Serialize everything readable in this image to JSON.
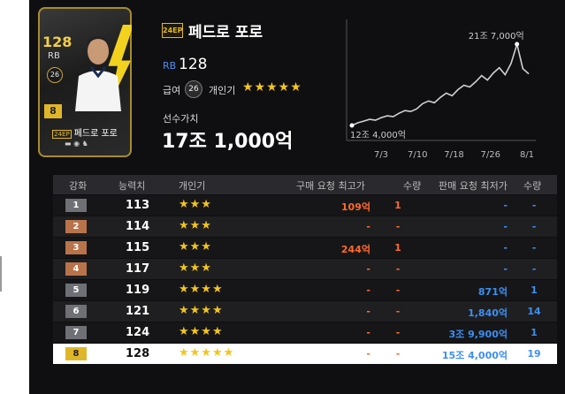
{
  "player": {
    "season_badge": "24EP",
    "name": "페드로 포로",
    "position": "RB",
    "ovr": "128",
    "wage_label": "급여",
    "wage_value": "26",
    "skill_label": "개인기",
    "skill_stars": "★★★★★",
    "value_label": "선수가치",
    "value": "17조 1,000억"
  },
  "card": {
    "ovr": "128",
    "position": "RB",
    "badge": "26",
    "level": "8",
    "name": "페드로 포로",
    "season_badge": "24EP"
  },
  "chart_data": {
    "type": "line",
    "x_ticks": [
      "7/3",
      "7/10",
      "7/18",
      "7/26",
      "8/1"
    ],
    "annotations": [
      {
        "text": "21조 7,000억",
        "role": "max"
      },
      {
        "text": "12조 4,000억",
        "role": "min"
      }
    ],
    "series": [
      {
        "values": [
          12.4,
          12.7,
          12.9,
          13.1,
          13.0,
          13.3,
          13.5,
          13.4,
          13.8,
          14.1,
          14.0,
          14.3,
          14.9,
          15.2,
          15.0,
          15.6,
          16.1,
          15.8,
          16.5,
          17.0,
          16.8,
          17.4,
          18.1,
          17.6,
          18.4,
          19.0,
          18.2,
          19.5,
          21.7,
          18.9,
          18.3
        ]
      }
    ]
  },
  "table": {
    "headers": {
      "level": "강화",
      "ovr": "능력치",
      "skill": "개인기",
      "buy_max": "구매 요청 최고가",
      "buy_qty": "수량",
      "sell_min": "판매 요청 최저가",
      "sell_qty": "수량"
    },
    "rows": [
      {
        "level": "1",
        "ovr": "113",
        "stars": "★★★",
        "buy": "109억",
        "buy_qty": "1",
        "sell": "-",
        "sell_qty": "-"
      },
      {
        "level": "2",
        "ovr": "114",
        "stars": "★★★",
        "buy": "-",
        "buy_qty": "-",
        "sell": "-",
        "sell_qty": "-"
      },
      {
        "level": "3",
        "ovr": "115",
        "stars": "★★★",
        "buy": "244억",
        "buy_qty": "1",
        "sell": "-",
        "sell_qty": "-"
      },
      {
        "level": "4",
        "ovr": "117",
        "stars": "★★★",
        "buy": "-",
        "buy_qty": "-",
        "sell": "-",
        "sell_qty": "-"
      },
      {
        "level": "5",
        "ovr": "119",
        "stars": "★★★★",
        "buy": "-",
        "buy_qty": "-",
        "sell": "871억",
        "sell_qty": "1"
      },
      {
        "level": "6",
        "ovr": "121",
        "stars": "★★★★",
        "buy": "-",
        "buy_qty": "-",
        "sell": "1,840억",
        "sell_qty": "14"
      },
      {
        "level": "7",
        "ovr": "124",
        "stars": "★★★★",
        "buy": "-",
        "buy_qty": "-",
        "sell": "3조 9,900억",
        "sell_qty": "1"
      },
      {
        "level": "8",
        "ovr": "128",
        "stars": "★★★★★",
        "buy": "-",
        "buy_qty": "-",
        "sell": "15조 4,000억",
        "sell_qty": "19"
      }
    ]
  },
  "colors": {
    "gold": "#e0b629",
    "buy": "#ff6a2a",
    "sell": "#3d8ff0",
    "star": "#f3c51c"
  }
}
